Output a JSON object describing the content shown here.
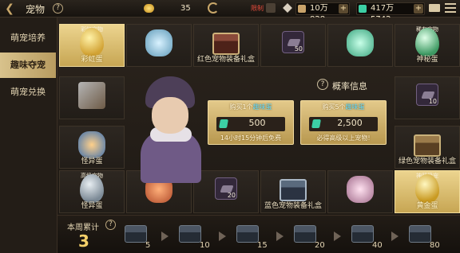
{
  "topbar": {
    "back_icon": "back-arrow-icon",
    "title": "宠物",
    "help": "?",
    "gold_value": "35",
    "limit_text": "限制",
    "res1_value": "10万828",
    "res2_value": "417万5742",
    "plus": "+"
  },
  "sidebar": {
    "items": [
      {
        "label": "萌宠培养"
      },
      {
        "label": "趣味夺宠"
      },
      {
        "label": "萌宠兑换"
      }
    ]
  },
  "slots": {
    "s1": {
      "tag": "彩虹宠物",
      "name": "彩虹蛋"
    },
    "s2": {
      "name": ""
    },
    "s3": {
      "name": "红色宠物装备礼盒"
    },
    "s4": {
      "count": "50"
    },
    "s5": {
      "name": ""
    },
    "s6": {
      "tag": "稀有宠物",
      "name": "神秘蛋"
    },
    "s7": {
      "name": ""
    },
    "s8": {
      "count": "10"
    },
    "s9": {
      "name": "怪异蛋"
    },
    "s10": {
      "name": "绿色宠物装备礼盒"
    },
    "s11": {
      "tag": "高级宠物",
      "name": "怪异蛋"
    },
    "s12": {
      "name": ""
    },
    "s13": {
      "count": "20"
    },
    "s14": {
      "name": "蓝色宠物装备礼盒"
    },
    "s15": {
      "name": ""
    },
    "s16": {
      "tag": "神器级宠",
      "name": "黄金蛋"
    }
  },
  "center": {
    "prob_help": "?",
    "prob_label": "概率信息",
    "buy1": {
      "label_a": "购买1个",
      "label_b": "趣味蛋",
      "price": "500",
      "note": "14小时15分钟后免费"
    },
    "buy5": {
      "label_a": "购买5个",
      "label_b": "趣味蛋",
      "price": "2,500",
      "note": "必得高级以上宠物!"
    }
  },
  "bottom": {
    "weekly_label": "本周累计",
    "weekly_help": "?",
    "weekly_count": "3",
    "milestones": [
      "5",
      "10",
      "15",
      "20",
      "40",
      "80"
    ]
  },
  "colors": {
    "accent_gold": "#d8c28c",
    "gem_green": "#3ccfa4",
    "highlight_blue": "#5fd9ff",
    "limit_red": "#e64b3c"
  }
}
